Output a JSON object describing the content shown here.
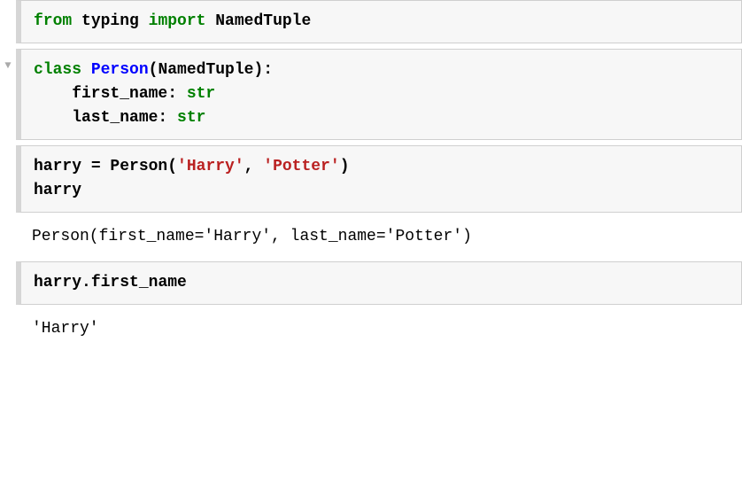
{
  "cells": [
    {
      "type": "input",
      "collapse": false,
      "tokens": [
        {
          "t": "from",
          "cls": "kw-green"
        },
        {
          "t": " typing ",
          "cls": "plain"
        },
        {
          "t": "import",
          "cls": "kw-green"
        },
        {
          "t": " NamedTuple",
          "cls": "plain"
        }
      ]
    },
    {
      "type": "input",
      "collapse": true,
      "tokens": [
        {
          "t": "class",
          "cls": "kw-green"
        },
        {
          "t": " ",
          "cls": "plain"
        },
        {
          "t": "Person",
          "cls": "kw-blue"
        },
        {
          "t": "(NamedTuple):",
          "cls": "plain"
        },
        {
          "t": "\n    first_name: ",
          "cls": "plain"
        },
        {
          "t": "str",
          "cls": "fn-green"
        },
        {
          "t": "\n    last_name: ",
          "cls": "plain"
        },
        {
          "t": "str",
          "cls": "fn-green"
        }
      ]
    },
    {
      "type": "input",
      "collapse": false,
      "tokens": [
        {
          "t": "harry ",
          "cls": "plain"
        },
        {
          "t": "=",
          "cls": "plain"
        },
        {
          "t": " Person(",
          "cls": "plain"
        },
        {
          "t": "'Harry'",
          "cls": "str-red"
        },
        {
          "t": ", ",
          "cls": "plain"
        },
        {
          "t": "'Potter'",
          "cls": "str-red"
        },
        {
          "t": ")\nharry",
          "cls": "plain"
        }
      ]
    },
    {
      "type": "output",
      "text": "Person(first_name='Harry', last_name='Potter')"
    },
    {
      "type": "input",
      "collapse": false,
      "tokens": [
        {
          "t": "harry",
          "cls": "plain"
        },
        {
          "t": ".",
          "cls": "plain"
        },
        {
          "t": "first_name",
          "cls": "plain"
        }
      ]
    },
    {
      "type": "output",
      "text": "'Harry'"
    }
  ],
  "collapse_glyph": "▼"
}
